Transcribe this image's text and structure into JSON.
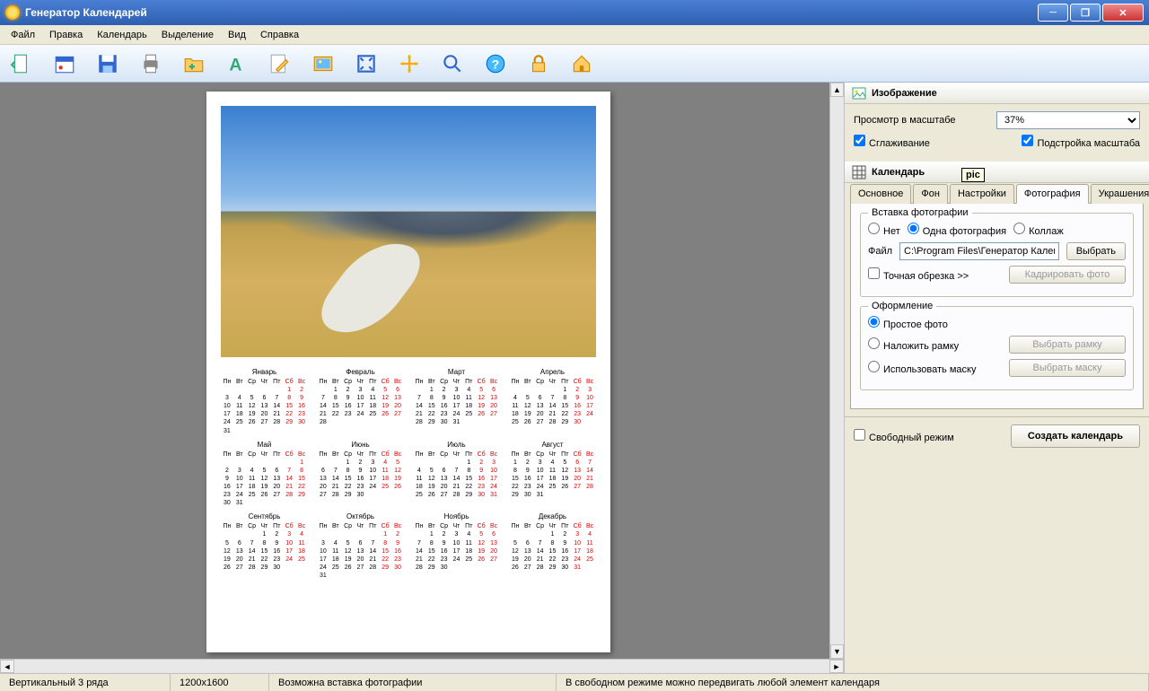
{
  "window": {
    "title": "Генератор Календарей"
  },
  "menu": {
    "file": "Файл",
    "edit": "Правка",
    "calendar": "Календарь",
    "selection": "Выделение",
    "view": "Вид",
    "help": "Справка"
  },
  "toolbar_icons": [
    "new",
    "calendar",
    "save",
    "print",
    "folder",
    "font",
    "edit",
    "picture",
    "fit",
    "move",
    "zoom",
    "help",
    "lock",
    "home"
  ],
  "panel": {
    "image_section": "Изображение",
    "scale_label": "Просмотр в масштабе",
    "scale_value": "37%",
    "smoothing": "Сглаживание",
    "fit_scale": "Подстройка масштаба",
    "calendar_section": "Календарь",
    "tooltip_pic": "pic",
    "tabs": {
      "main": "Основное",
      "bg": "Фон",
      "settings": "Настройки",
      "photo": "Фотография",
      "decor": "Украшения"
    },
    "insert_group": "Вставка фотографии",
    "radio_none": "Нет",
    "radio_one": "Одна фотография",
    "radio_collage": "Коллаж",
    "file_label": "Файл",
    "file_value": "C:\\Program Files\\Генератор Календар",
    "choose_btn": "Выбрать",
    "crop_check": "Точная обрезка >>",
    "crop_btn": "Кадрировать фото",
    "style_group": "Оформление",
    "style_plain": "Простое фото",
    "style_frame": "Наложить рамку",
    "style_mask": "Использовать маску",
    "choose_frame": "Выбрать рамку",
    "choose_mask": "Выбрать маску",
    "free_mode": "Свободный режим",
    "create_btn": "Создать календарь"
  },
  "status": {
    "layout": "Вертикальный 3 ряда",
    "size": "1200x1600",
    "photo_hint": "Возможна вставка фотографии",
    "free_hint": "В свободном режиме можно передвигать любой элемент календаря"
  },
  "months": [
    "Январь",
    "Февраль",
    "Март",
    "Апрель",
    "Май",
    "Июнь",
    "Июль",
    "Август",
    "Сентябрь",
    "Октябрь",
    "Ноябрь",
    "Декабрь"
  ],
  "weekdays": [
    "Пн",
    "Вт",
    "Ср",
    "Чт",
    "Пт",
    "Сб",
    "Вс"
  ],
  "month_start_col": [
    5,
    1,
    1,
    4,
    6,
    2,
    4,
    0,
    3,
    5,
    1,
    3
  ],
  "month_days": [
    31,
    28,
    31,
    30,
    31,
    30,
    31,
    31,
    30,
    31,
    30,
    31
  ]
}
